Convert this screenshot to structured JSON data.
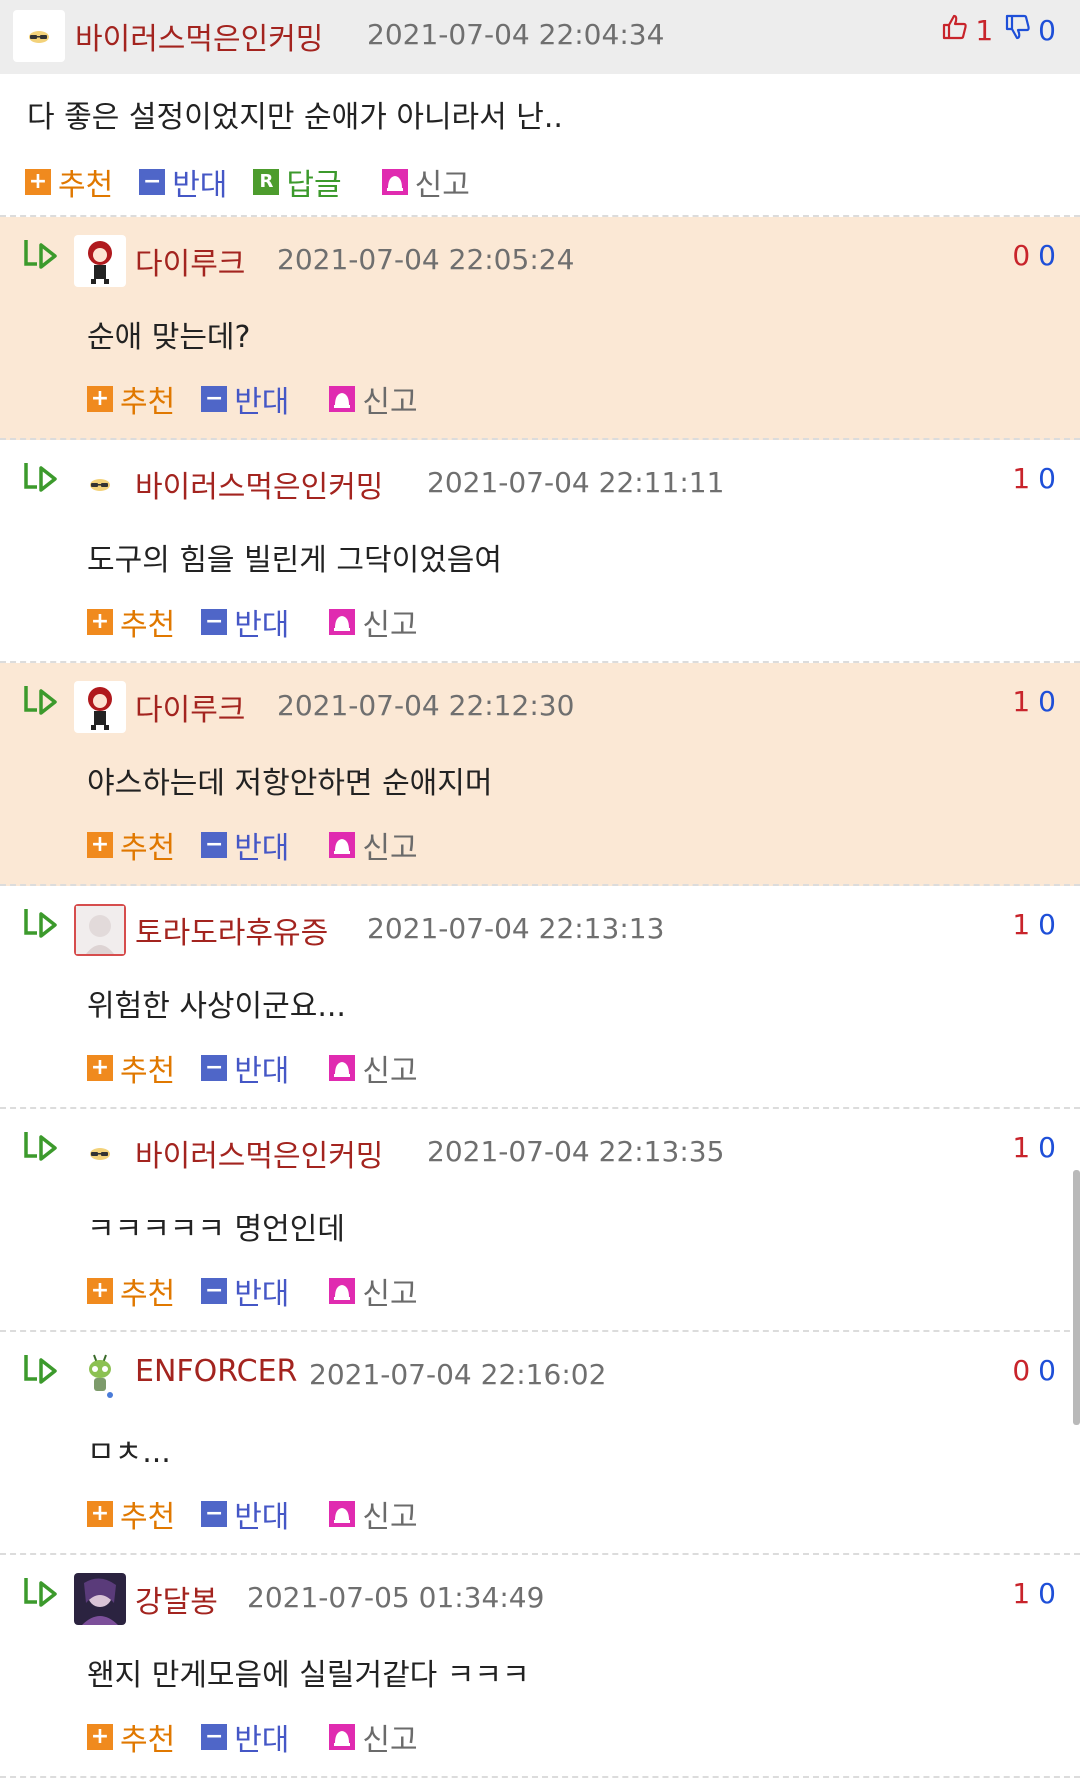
{
  "actions": {
    "recommend": "추천",
    "oppose": "반대",
    "reply": "답글",
    "report": "신고"
  },
  "colors": {
    "nick": "#a3241f",
    "vote_up": "#c8242b",
    "vote_down": "#1e4fd8",
    "highlight_bg": "#fbe8d5",
    "header_bg": "#ededed"
  },
  "comments": [
    {
      "level": "root",
      "avatar": "sunglasses-emoji",
      "nick": "바이러스먹은인커밍",
      "date": "2021-07-04 22:04:34",
      "up": "1",
      "down": "0",
      "text": "다 좋은 설정이었지만 순애가 아니라서 난..",
      "highlight": false
    },
    {
      "level": "reply",
      "avatar": "red-hair-character",
      "nick": "다이루크",
      "date": "2021-07-04 22:05:24",
      "up": "0",
      "down": "0",
      "text": "순애 맞는데?",
      "highlight": true
    },
    {
      "level": "reply",
      "avatar": "sunglasses-emoji",
      "nick": "바이러스먹은인커밍",
      "date": "2021-07-04 22:11:11",
      "up": "1",
      "down": "0",
      "text": "도구의 힘을 빌린게 그닥이었음여",
      "highlight": false
    },
    {
      "level": "reply",
      "avatar": "red-hair-character",
      "nick": "다이루크",
      "date": "2021-07-04 22:12:30",
      "up": "1",
      "down": "0",
      "text": "야스하는데 저항안하면 순애지머",
      "highlight": true
    },
    {
      "level": "reply",
      "avatar": "anime-portrait",
      "nick": "토라도라후유증",
      "date": "2021-07-04 22:13:13",
      "up": "1",
      "down": "0",
      "text": "위험한 사상이군요...",
      "highlight": false
    },
    {
      "level": "reply",
      "avatar": "sunglasses-emoji",
      "nick": "바이러스먹은인커밍",
      "date": "2021-07-04 22:13:35",
      "up": "1",
      "down": "0",
      "text": "ㅋㅋㅋㅋㅋ 명언인데",
      "highlight": false
    },
    {
      "level": "reply",
      "avatar": "alien-character",
      "nick": "ENFORCER",
      "date": "2021-07-04 22:16:02",
      "up": "0",
      "down": "0",
      "text": "ㅁㅊ...",
      "highlight": false
    },
    {
      "level": "reply",
      "avatar": "dark-anime-portrait",
      "nick": "강달봉",
      "date": "2021-07-05 01:34:49",
      "up": "1",
      "down": "0",
      "text": "왠지 만게모음에 실릴거같다 ㅋㅋㅋ",
      "highlight": false
    }
  ]
}
